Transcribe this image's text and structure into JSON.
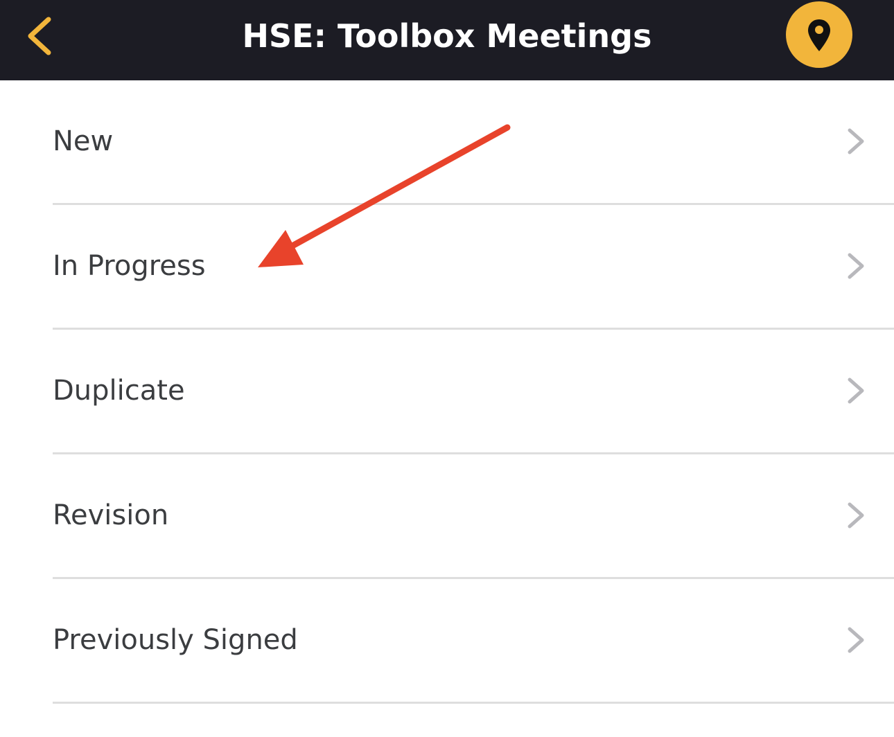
{
  "header": {
    "title": "HSE: Toolbox Meetings",
    "back_icon": "chevron-left-icon",
    "location_icon": "map-pin-icon",
    "background_color": "#1c1c24",
    "accent_color": "#f2b53b"
  },
  "list": {
    "items": [
      {
        "label": "New"
      },
      {
        "label": "In Progress"
      },
      {
        "label": "Duplicate"
      },
      {
        "label": "Revision"
      },
      {
        "label": "Previously Signed"
      }
    ],
    "chevron_icon": "chevron-right-icon"
  },
  "annotation": {
    "arrow_color": "#e8432b",
    "icon": "red-arrow-icon"
  }
}
